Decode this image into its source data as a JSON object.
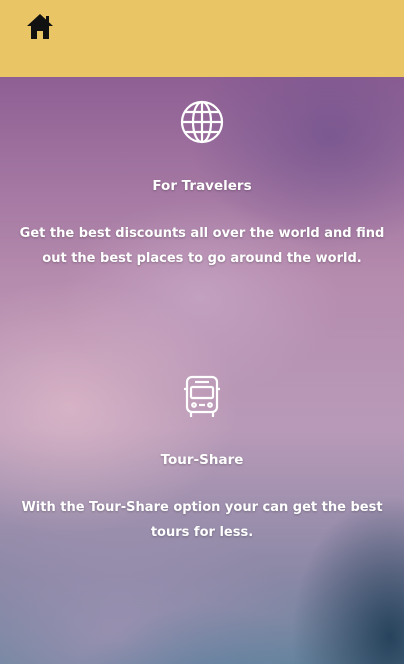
{
  "header": {
    "home_icon": "home-icon",
    "background_color": "#eac565"
  },
  "features": [
    {
      "icon": "globe-icon",
      "title": "For Travelers",
      "description": "Get the best discounts all over the world and find out the best places to go around the world."
    },
    {
      "icon": "bus-icon",
      "title": "Tour-Share",
      "description": "With the Tour-Share option your can get the best tours for less."
    }
  ]
}
